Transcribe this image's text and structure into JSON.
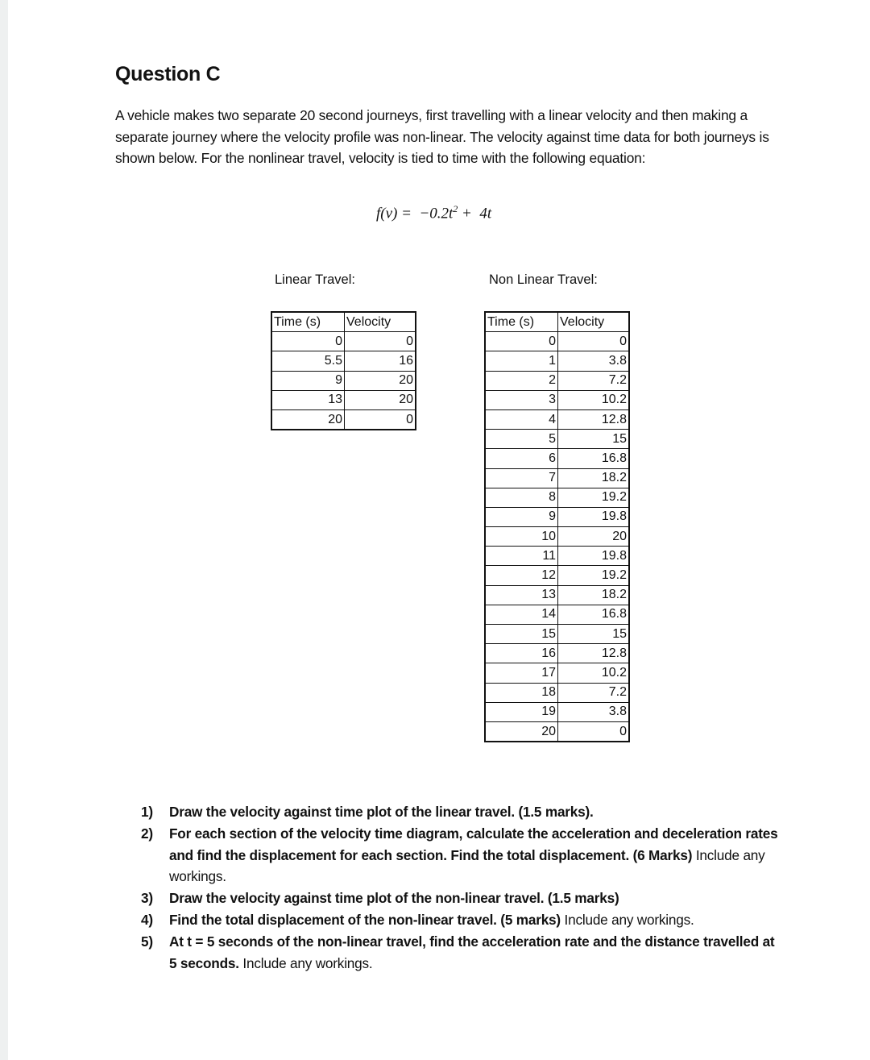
{
  "document": {
    "title": "Question C",
    "intro": "A vehicle makes two separate 20 second journeys, first travelling with a linear velocity and then making a separate journey where the velocity profile was non-linear. The velocity against time data for both journeys is shown below. For the nonlinear travel, velocity is tied to time with the following equation:",
    "equation": {
      "lhs": "f(v) =  −0.2t",
      "exponent": "2",
      "rhs": " +  4t"
    }
  },
  "linear_table": {
    "label": "Linear Travel:",
    "headers": [
      "Time (s)",
      "Velocity"
    ],
    "rows": [
      [
        "0",
        "0"
      ],
      [
        "5.5",
        "16"
      ],
      [
        "9",
        "20"
      ],
      [
        "13",
        "20"
      ],
      [
        "20",
        "0"
      ]
    ]
  },
  "nonlinear_table": {
    "label": "Non Linear Travel:",
    "headers": [
      "Time (s)",
      "Velocity"
    ],
    "rows": [
      [
        "0",
        "0"
      ],
      [
        "1",
        "3.8"
      ],
      [
        "2",
        "7.2"
      ],
      [
        "3",
        "10.2"
      ],
      [
        "4",
        "12.8"
      ],
      [
        "5",
        "15"
      ],
      [
        "6",
        "16.8"
      ],
      [
        "7",
        "18.2"
      ],
      [
        "8",
        "19.2"
      ],
      [
        "9",
        "19.8"
      ],
      [
        "10",
        "20"
      ],
      [
        "11",
        "19.8"
      ],
      [
        "12",
        "19.2"
      ],
      [
        "13",
        "18.2"
      ],
      [
        "14",
        "16.8"
      ],
      [
        "15",
        "15"
      ],
      [
        "16",
        "12.8"
      ],
      [
        "17",
        "10.2"
      ],
      [
        "18",
        "7.2"
      ],
      [
        "19",
        "3.8"
      ],
      [
        "20",
        "0"
      ]
    ]
  },
  "questions": [
    {
      "num": "1)",
      "bold": "Draw the velocity against time plot of the linear travel. (1.5 marks).",
      "normal": ""
    },
    {
      "num": "2)",
      "bold": "For each section of the velocity time diagram, calculate the acceleration and deceleration rates and find the displacement for each section. Find the total displacement. (6 Marks)",
      "normal": " Include any workings."
    },
    {
      "num": "3)",
      "bold": "Draw the velocity against time plot of the non-linear travel. (1.5 marks)",
      "normal": ""
    },
    {
      "num": "4)",
      "bold": "Find the total displacement of the non-linear travel. (5 marks)",
      "normal": " Include any workings."
    },
    {
      "num": "5)",
      "bold": "At t = 5 seconds of the non-linear travel, find the acceleration rate and the distance travelled at 5 seconds.",
      "normal": " Include any workings."
    }
  ]
}
